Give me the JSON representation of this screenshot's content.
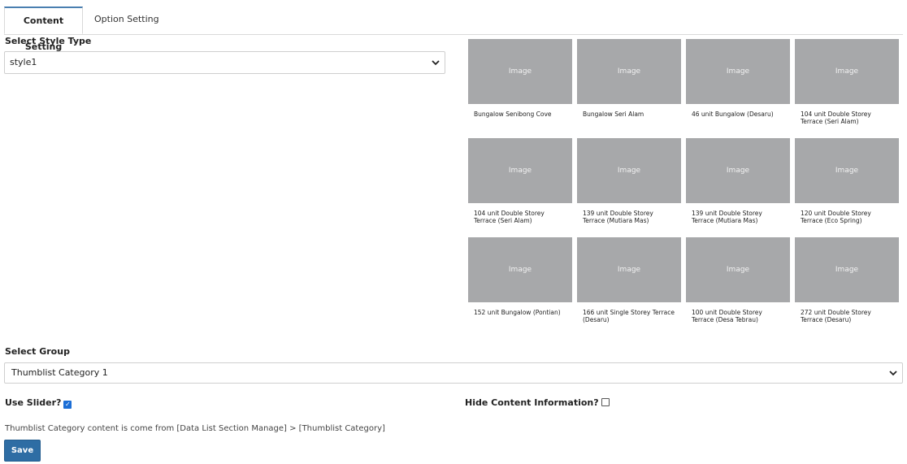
{
  "tabs": [
    {
      "label": "Content Setting",
      "active": true
    },
    {
      "label": "Option Setting",
      "active": false
    }
  ],
  "style_select": {
    "label": "Select Style Type",
    "value": "style1"
  },
  "thumbnails": [
    {
      "image_text": "Image",
      "caption": "Bungalow Senibong Cove"
    },
    {
      "image_text": "Image",
      "caption": "Bungalow Seri Alam"
    },
    {
      "image_text": "Image",
      "caption": "46 unit Bungalow (Desaru)"
    },
    {
      "image_text": "Image",
      "caption": "104 unit Double Storey Terrace (Seri Alam)"
    },
    {
      "image_text": "Image",
      "caption": "104 unit Double Storey Terrace (Seri Alam)"
    },
    {
      "image_text": "Image",
      "caption": "139 unit Double Storey Terrace (Mutiara Mas)"
    },
    {
      "image_text": "Image",
      "caption": "139 unit Double Storey Terrace (Mutiara Mas)"
    },
    {
      "image_text": "Image",
      "caption": "120 unit Double Storey Terrace (Eco Spring)"
    },
    {
      "image_text": "Image",
      "caption": "152 unit Bungalow (Pontian)"
    },
    {
      "image_text": "Image",
      "caption": "166 unit Single Storey Terrace (Desaru)"
    },
    {
      "image_text": "Image",
      "caption": "100 unit Double Storey Terrace (Desa Tebrau)"
    },
    {
      "image_text": "Image",
      "caption": "272 unit Double Storey Terrace (Desaru)"
    }
  ],
  "group_select": {
    "label": "Select Group",
    "value": "Thumblist Category 1"
  },
  "use_slider": {
    "label": "Use Slider?",
    "checked": true
  },
  "hide_content": {
    "label": "Hide Content Information?",
    "checked": false
  },
  "note": "Thumblist Category content is come from [Data List Section Manage] > [Thumblist Category]",
  "save_label": "Save",
  "colors": {
    "accent": "#2e6da4",
    "placeholder": "#a7a8aa"
  }
}
